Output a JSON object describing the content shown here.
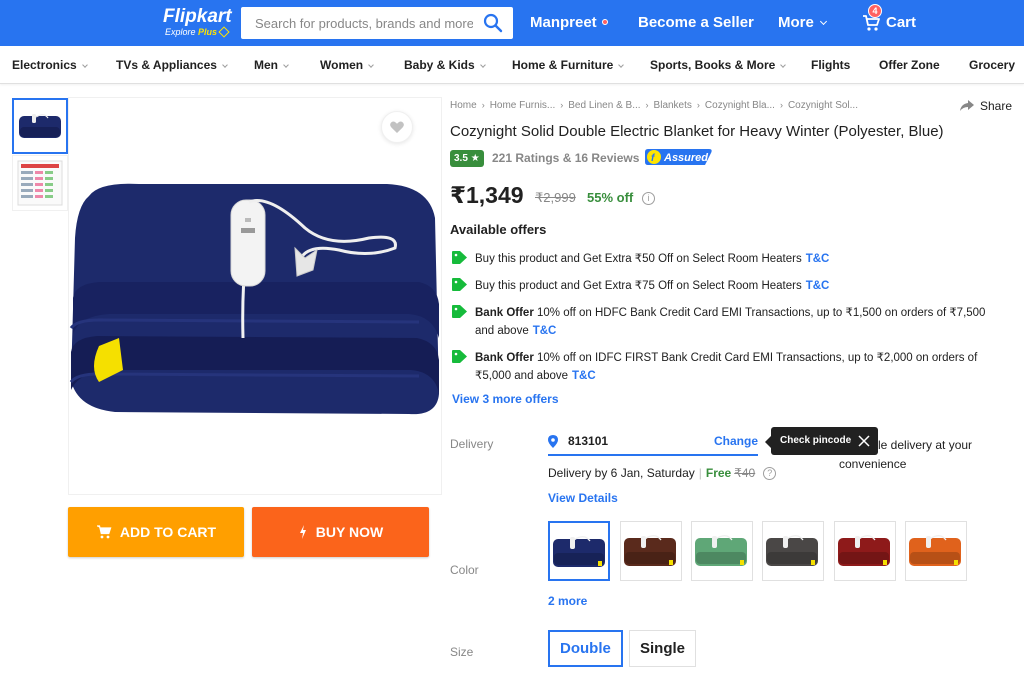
{
  "header": {
    "logo_text": "Flipkart",
    "logo_sub_prefix": "Explore",
    "logo_sub_plus": "Plus",
    "search_placeholder": "Search for products, brands and more",
    "user_name": "Manpreet",
    "seller_label": "Become a Seller",
    "more_label": "More",
    "cart_label": "Cart",
    "cart_count": "4",
    "colors": {
      "bar": "#2874f0",
      "accent": "#ffe500",
      "badge": "#ff6161"
    }
  },
  "categories": [
    "Electronics",
    "TVs & Appliances",
    "Men",
    "Women",
    "Baby & Kids",
    "Home & Furniture",
    "Sports, Books & More",
    "Flights",
    "Offer Zone",
    "Grocery"
  ],
  "gallery": {
    "thumbnails": [
      "blanket-navy-thumb",
      "size-chart-thumb"
    ],
    "wishlist_icon": "heart-icon"
  },
  "actions": {
    "add_to_cart": "ADD TO CART",
    "buy_now": "BUY NOW",
    "colors": {
      "add_to_cart": "#ff9f00",
      "buy_now": "#fb641b"
    }
  },
  "breadcrumbs": [
    "Home",
    "Home Furnis...",
    "Bed Linen & B...",
    "Blankets",
    "Cozynight Bla...",
    "Cozynight Sol..."
  ],
  "share_label": "Share",
  "product": {
    "title": "Cozynight Solid Double Electric Blanket for Heavy Winter  (Polyester, Blue)",
    "rating": "3.5",
    "rating_text": "221 Ratings & 16 Reviews",
    "assured_label": "Assured",
    "price": "₹1,349",
    "mrp": "₹2,999",
    "discount": "55% off"
  },
  "offers": {
    "heading": "Available offers",
    "items": [
      {
        "bold": "",
        "text": "Buy this product and Get Extra ₹50 Off on Select Room Heaters",
        "tc": "T&C"
      },
      {
        "bold": "",
        "text": "Buy this product and Get Extra ₹75 Off on Select Room Heaters",
        "tc": "T&C"
      },
      {
        "bold": "Bank Offer",
        "text": "10% off on HDFC Bank Credit Card EMI Transactions, up to ₹1,500 on orders of ₹7,500 and above",
        "tc": "T&C"
      },
      {
        "bold": "Bank Offer",
        "text": "10% off on IDFC FIRST Bank Credit Card EMI Transactions, up to ₹2,000 on orders of ₹5,000 and above",
        "tc": "T&C"
      }
    ],
    "view_more": "View 3 more offers"
  },
  "delivery": {
    "label": "Delivery",
    "pincode": "813101",
    "change_label": "Change",
    "tooltip": "Check pincode",
    "behind_line1": "le delivery at your",
    "behind_line2": "convenience",
    "delivery_by": "Delivery by 6 Jan, Saturday",
    "free_label": "Free",
    "free_strike": "₹40",
    "view_details": "View Details"
  },
  "color": {
    "label": "Color",
    "swatches": [
      {
        "name": "navy",
        "hex": "#1d2a6b"
      },
      {
        "name": "brown",
        "hex": "#5a2a1c"
      },
      {
        "name": "green",
        "hex": "#5fa777"
      },
      {
        "name": "grey",
        "hex": "#4a4746"
      },
      {
        "name": "maroon",
        "hex": "#8e1a1a"
      },
      {
        "name": "orange",
        "hex": "#e0621c"
      }
    ],
    "more_label": "2 more"
  },
  "size": {
    "label": "Size",
    "options": [
      "Double",
      "Single"
    ],
    "selected": "Double"
  }
}
